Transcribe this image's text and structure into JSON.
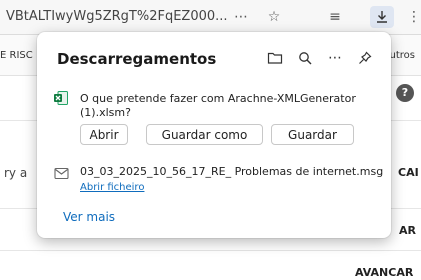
{
  "browser": {
    "url_text": "VBtALTIwyWg5ZRgT%2FqEZ000...",
    "favorites_left": "E RISC",
    "favorites_right": "utros"
  },
  "background_page": {
    "left_text": "ry a",
    "right_label_1": "CAI",
    "right_label_2": "AR",
    "bottom_label": "AVANCAR",
    "help_icon_text": "?"
  },
  "downloads": {
    "title": "Descarregamentos",
    "items": [
      {
        "icon": "excel-file-icon",
        "question": "O que pretende fazer com Arachne-XMLGenerator (1).xlsm?",
        "open_label": "Abrir",
        "save_as_label": "Guardar como",
        "save_label": "Guardar"
      },
      {
        "icon": "mail-file-icon",
        "filename": "03_03_2025_10_56_17_RE_ Problemas de internet.msg",
        "open_file_label": "Abrir ficheiro"
      }
    ],
    "more_label": "Ver mais"
  }
}
